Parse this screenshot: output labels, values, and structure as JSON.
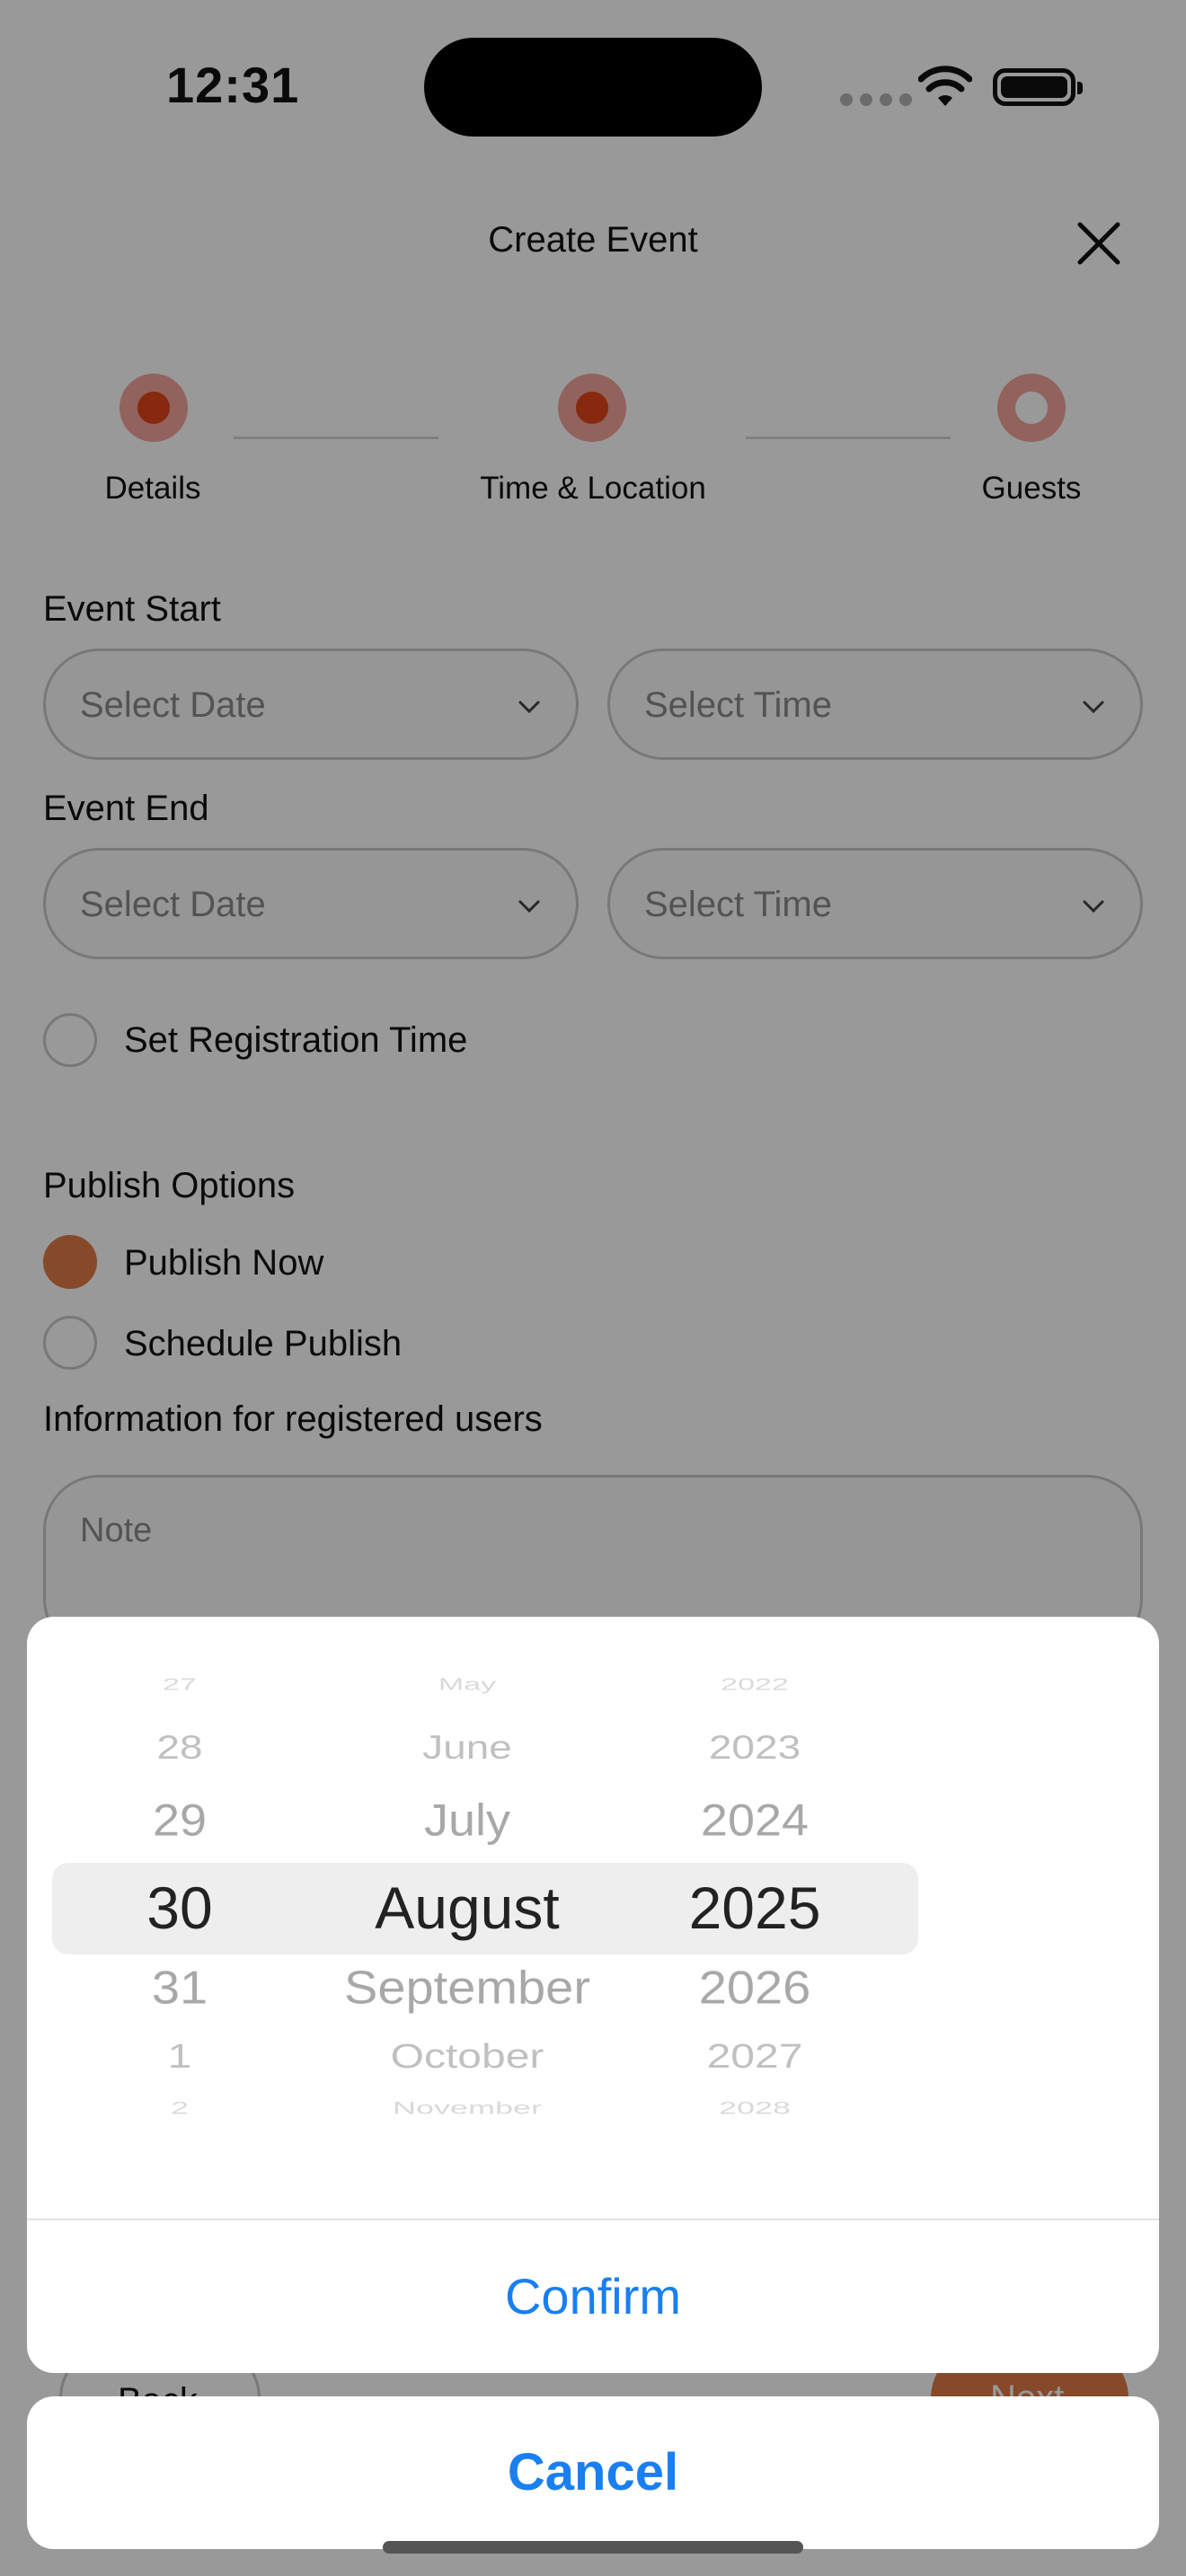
{
  "status_bar": {
    "time": "12:31"
  },
  "header": {
    "title": "Create Event",
    "close_icon": "close-icon"
  },
  "stepper": {
    "steps": [
      {
        "label": "Details",
        "state": "done"
      },
      {
        "label": "Time & Location",
        "state": "active"
      },
      {
        "label": "Guests",
        "state": "pending"
      }
    ]
  },
  "form": {
    "event_start": {
      "label": "Event Start",
      "date_placeholder": "Select Date",
      "time_placeholder": "Select Time"
    },
    "event_end": {
      "label": "Event End",
      "date_placeholder": "Select Date",
      "time_placeholder": "Select Time"
    },
    "registration_time": {
      "label": "Set Registration Time",
      "checked": false
    },
    "publish_options": {
      "label": "Publish Options",
      "options": [
        {
          "label": "Publish Now",
          "selected": true
        },
        {
          "label": "Schedule Publish",
          "selected": false
        }
      ]
    },
    "info": {
      "label": "Information for registered users",
      "note_placeholder": "Note"
    },
    "back_label": "Back",
    "next_label": "Next"
  },
  "date_picker": {
    "days": [
      "27",
      "28",
      "29",
      "30",
      "31",
      "1",
      "2"
    ],
    "months": [
      "May",
      "June",
      "July",
      "August",
      "September",
      "October",
      "November"
    ],
    "years": [
      "2022",
      "2023",
      "2024",
      "2025",
      "2026",
      "2027",
      "2028"
    ],
    "selected": {
      "day": "30",
      "month": "August",
      "year": "2025"
    },
    "confirm_label": "Confirm",
    "cancel_label": "Cancel"
  },
  "colors": {
    "accent": "#e07b47",
    "step_active": "#e0451a",
    "link_blue": "#1a7ff0"
  }
}
